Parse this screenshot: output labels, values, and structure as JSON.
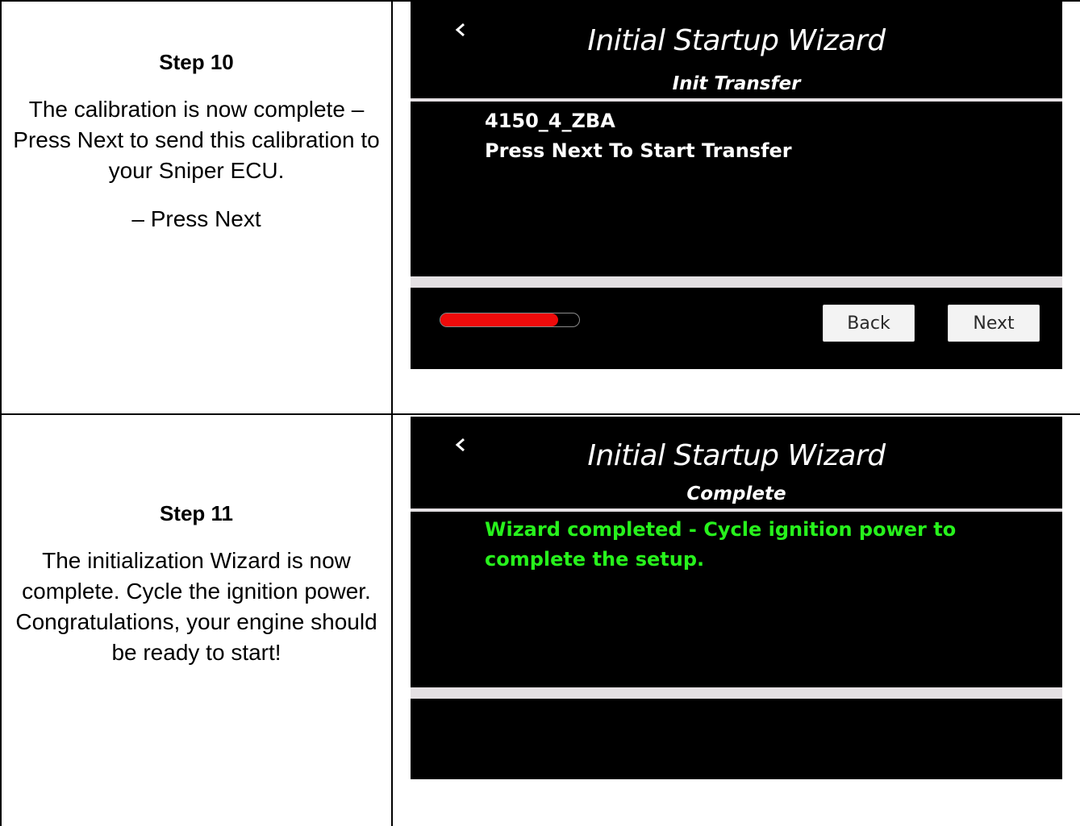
{
  "rows": [
    {
      "step_title": "Step 10",
      "paragraphs": [
        "The calibration is now complete – Press Next to send this calibration to your Sniper ECU.",
        "– Press Next"
      ],
      "screen": {
        "title": "Initial Startup Wizard",
        "subtitle": "Init Transfer",
        "lines": [
          "4150_4_ZBA",
          "Press Next To Start Transfer"
        ],
        "progress": 0.85,
        "progress_color": "#ee0b0b",
        "back_label": "Back",
        "next_label": "Next"
      }
    },
    {
      "step_title": "Step 11",
      "paragraphs": [
        "The initialization Wizard is now complete. Cycle the ignition power. Congratulations, your engine should be ready to start!"
      ],
      "screen": {
        "title": "Initial Startup Wizard",
        "subtitle": "Complete",
        "lines": [
          "Wizard completed - Cycle ignition power to",
          "complete the setup."
        ],
        "text_color": "#27f21c"
      }
    }
  ]
}
